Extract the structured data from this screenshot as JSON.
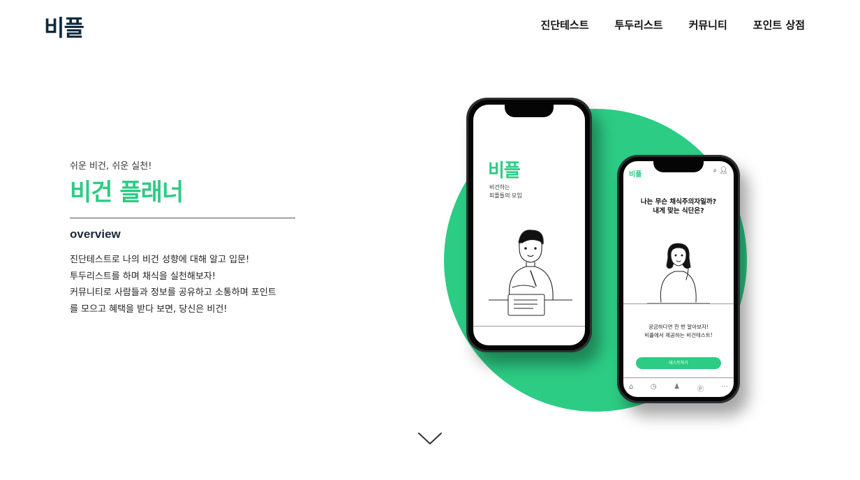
{
  "header": {
    "logo": "비플",
    "nav": [
      {
        "label": "진단테스트"
      },
      {
        "label": "투두리스트"
      },
      {
        "label": "커뮤니티"
      },
      {
        "label": "포인트 상점"
      }
    ]
  },
  "hero": {
    "tagline": "쉬운 비건, 쉬운 실천!",
    "title": "비건 플래너",
    "overview_heading": "overview",
    "description": [
      "진단테스트로 나의 비건 성향에 대해 알고 입문!",
      "투두리스트를 하며 채식을 실천해보자!",
      "커뮤니티로 사람들과 정보를 공유하고 소통하며 포인트",
      "를 모으고 혜택을 받다 보면, 당신은 비건!"
    ]
  },
  "phone_left": {
    "logo": "비플",
    "subtitle_line1": "비건하는",
    "subtitle_line2": "피플들의 모임"
  },
  "phone_right": {
    "header_logo": "비플",
    "question_line1": "나는 무슨 채식주의자일까?",
    "question_line2": "내게 맞는 식단은?",
    "info_line1": "궁금하다면 한 번 알아보자!",
    "info_line2": "비플에서 제공하는 비건테스트!",
    "button_label": "테스트하기"
  },
  "colors": {
    "brand_green": "#2ccc84",
    "logo_navy": "#0f2a3e"
  },
  "icons": {
    "scroll_down": "chevron-down-icon",
    "search": "search-icon",
    "user": "user-icon",
    "home": "home-icon",
    "compass": "compass-icon",
    "people": "people-icon",
    "point": "point-icon",
    "more": "more-icon"
  }
}
